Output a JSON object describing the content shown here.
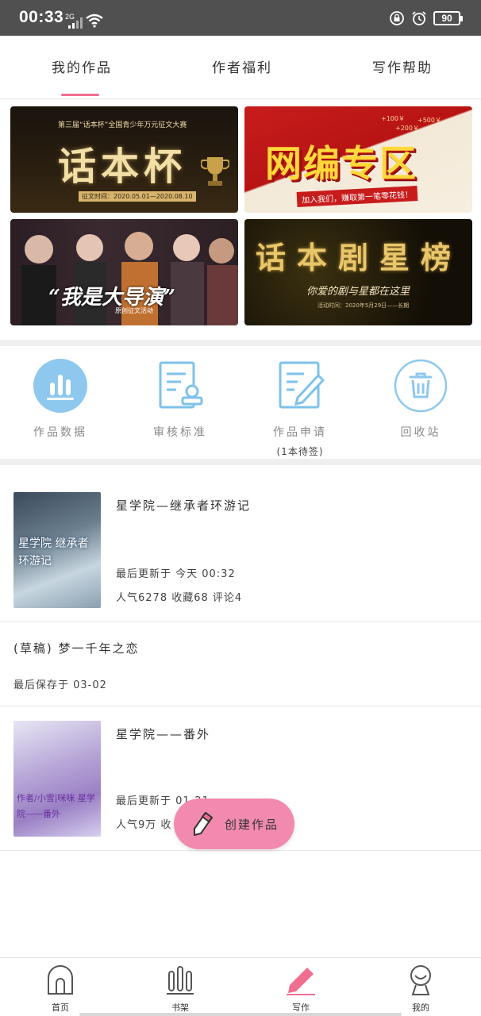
{
  "status_bar": {
    "time": "00:33",
    "network": "2G",
    "battery": "90"
  },
  "tabs": [
    {
      "label": "我的作品",
      "active": true
    },
    {
      "label": "作者福利",
      "active": false
    },
    {
      "label": "写作帮助",
      "active": false
    }
  ],
  "accent_color": "#f06e90",
  "banners": {
    "b1": {
      "top_text": "第三届“话本杯”全国青少年万元征文大赛",
      "big": "话本杯",
      "date": "征文时间：2020.05.01—2020.08.10"
    },
    "b2": {
      "bonus1": "+100￥",
      "bonus2": "+500￥",
      "bonus3": "+200￥",
      "big": "网编专区",
      "strip": "加入我们，赚取第一笔零花钱！"
    },
    "b3": {
      "big": "“我是大导演”",
      "sub": "原创征文活动"
    },
    "b4": {
      "big": "话本剧星榜",
      "sub": "你爱的剧与星都在这里",
      "date": "活动时间：2020年5月29日——长期"
    }
  },
  "features": [
    {
      "label": "作品数据",
      "icon": "bar-chart-icon"
    },
    {
      "label": "审核标准",
      "icon": "review-standard-icon"
    },
    {
      "label": "作品申请",
      "icon": "edit-document-icon",
      "sub": "(1本待签)"
    },
    {
      "label": "回收站",
      "icon": "trash-icon"
    }
  ],
  "works": [
    {
      "title": "星学院—继承者环游记",
      "cover_text": "星学院 继承者环游记",
      "updated": "最后更新于 今天 00:32",
      "stats": "人气6278 收藏68 评论4"
    },
    {
      "title": "(草稿) 梦一千年之恋",
      "saved": "最后保存于 03-02"
    },
    {
      "title": "星学院——番外",
      "cover_text": "作者/小雪|咪咪 星学院——番外",
      "updated": "最后更新于 01-21",
      "stats": "人气9万 收"
    }
  ],
  "fab": {
    "label": "创建作品"
  },
  "bottom_nav": [
    {
      "label": "首页",
      "icon": "home-icon"
    },
    {
      "label": "书架",
      "icon": "bookshelf-icon"
    },
    {
      "label": "写作",
      "icon": "pen-icon",
      "active": true
    },
    {
      "label": "我的",
      "icon": "profile-icon"
    }
  ]
}
